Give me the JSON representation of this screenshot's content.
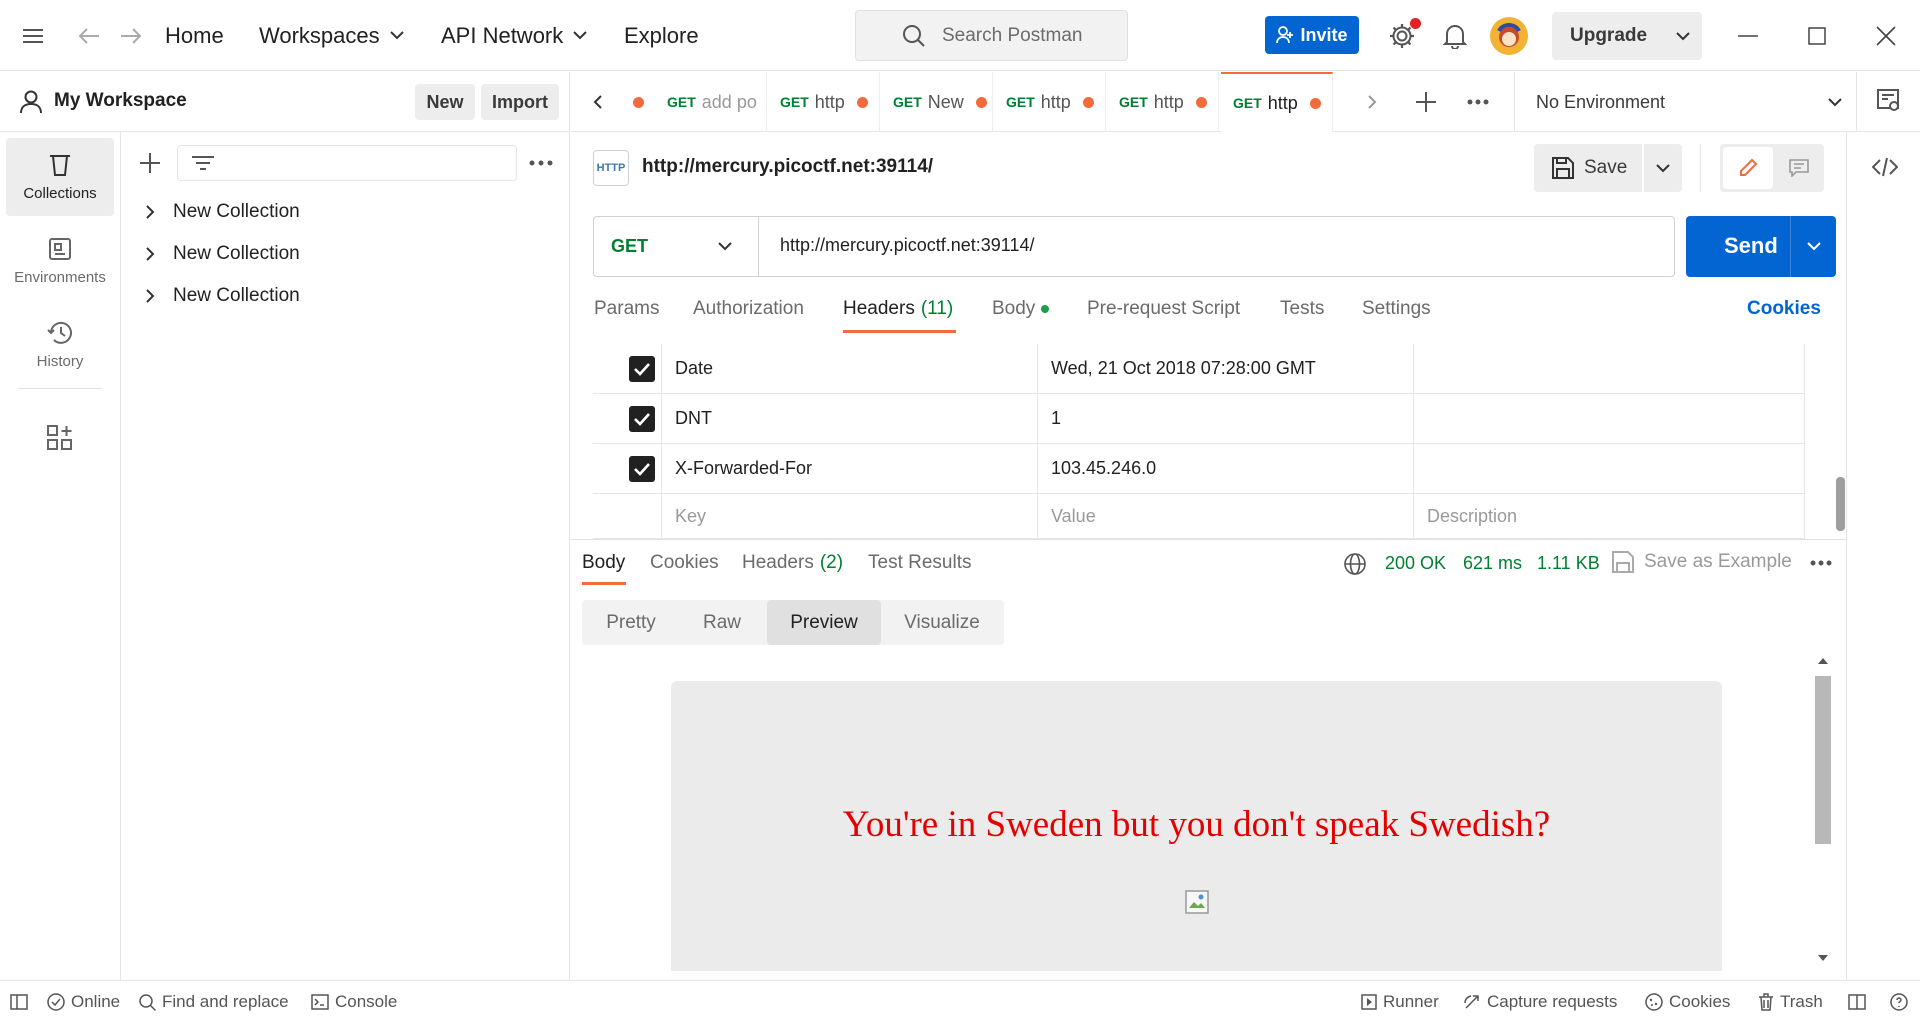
{
  "nav": {
    "home": "Home",
    "workspaces": "Workspaces",
    "api_network": "API Network",
    "explore": "Explore",
    "search_placeholder": "Search Postman",
    "invite": "Invite",
    "upgrade": "Upgrade"
  },
  "workspace": {
    "name": "My Workspace",
    "new": "New",
    "import": "Import"
  },
  "rail": {
    "collections": "Collections",
    "environments": "Environments",
    "history": "History"
  },
  "collections": [
    "New Collection",
    "New Collection",
    "New Collection"
  ],
  "tabs": [
    {
      "method": "GET",
      "label": "add po"
    },
    {
      "method": "GET",
      "label": "http"
    },
    {
      "method": "GET",
      "label": "New"
    },
    {
      "method": "GET",
      "label": "http"
    },
    {
      "method": "GET",
      "label": "http"
    },
    {
      "method": "GET",
      "label": "http"
    }
  ],
  "environment": "No Environment",
  "request": {
    "title_url": "http://mercury.picoctf.net:39114/",
    "http_badge": "HTTP",
    "save": "Save",
    "method": "GET",
    "url": "http://mercury.picoctf.net:39114/",
    "send": "Send"
  },
  "request_tabs": {
    "params": "Params",
    "authorization": "Authorization",
    "headers": "Headers",
    "headers_count": "(11)",
    "body": "Body",
    "pre_request": "Pre-request Script",
    "tests": "Tests",
    "settings": "Settings",
    "cookies": "Cookies"
  },
  "headers": [
    {
      "key": "Date",
      "value": "Wed, 21 Oct 2018 07:28:00 GMT"
    },
    {
      "key": "DNT",
      "value": "1"
    },
    {
      "key": "X-Forwarded-For",
      "value": "103.45.246.0"
    }
  ],
  "headers_placeholder": {
    "key": "Key",
    "value": "Value",
    "description": "Description"
  },
  "response_tabs": {
    "body": "Body",
    "cookies": "Cookies",
    "headers": "Headers",
    "headers_count": "(2)",
    "test_results": "Test Results"
  },
  "response_meta": {
    "status": "200 OK",
    "time": "621 ms",
    "size": "1.11 KB",
    "save_example": "Save as Example"
  },
  "view_modes": {
    "pretty": "Pretty",
    "raw": "Raw",
    "preview": "Preview",
    "visualize": "Visualize"
  },
  "preview_text": "You're in Sweden but you don't speak Swedish?",
  "statusbar": {
    "online": "Online",
    "find_replace": "Find and replace",
    "console": "Console",
    "runner": "Runner",
    "capture": "Capture requests",
    "cookies": "Cookies",
    "trash": "Trash"
  }
}
